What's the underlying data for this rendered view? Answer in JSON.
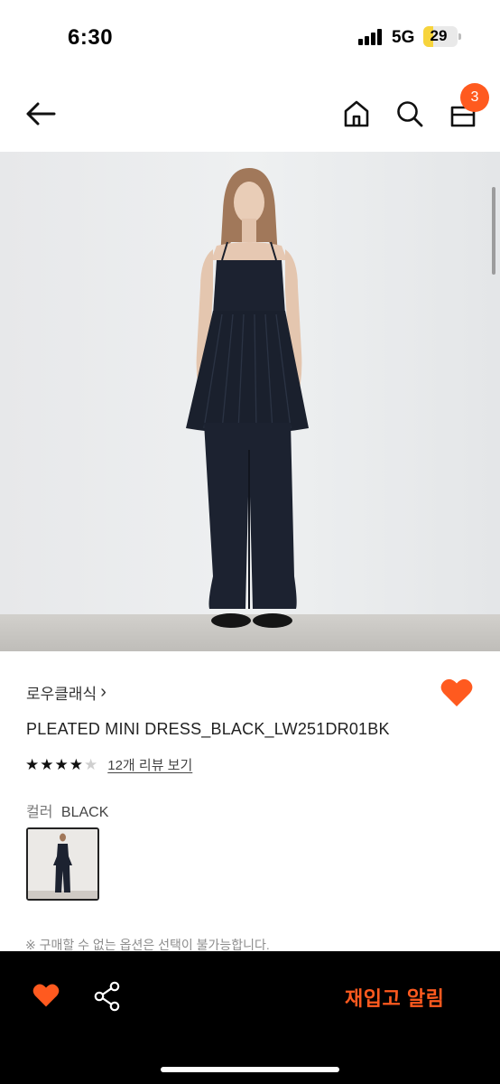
{
  "status_bar": {
    "time": "6:30",
    "network": "5G",
    "battery": "29",
    "battery_level": 0.29
  },
  "header": {
    "back_icon": "arrow-left-icon",
    "home_icon": "home-icon",
    "search_icon": "search-icon",
    "cart_icon": "shopping-bag-icon",
    "cart_count": "3"
  },
  "product": {
    "brand": "로우클래식",
    "brand_chevron": "›",
    "title": "PLEATED MINI DRESS_BLACK_LW251DR01BK",
    "rating_stars": 4,
    "rating_max": 5,
    "review_link": "12개 리뷰 보기",
    "color_label": "컬러",
    "color_value": "BLACK",
    "notice": "※ 구매할 수 없는 옵션은 선택이 불가능합니다."
  },
  "bottom_bar": {
    "like_icon": "heart-icon",
    "share_icon": "share-icon",
    "restock_label": "재입고 알림"
  },
  "colors": {
    "accent": "#ff5a1f",
    "bar_bg": "#000000",
    "stars_on": "#111111",
    "stars_off": "#cfcfcf"
  }
}
